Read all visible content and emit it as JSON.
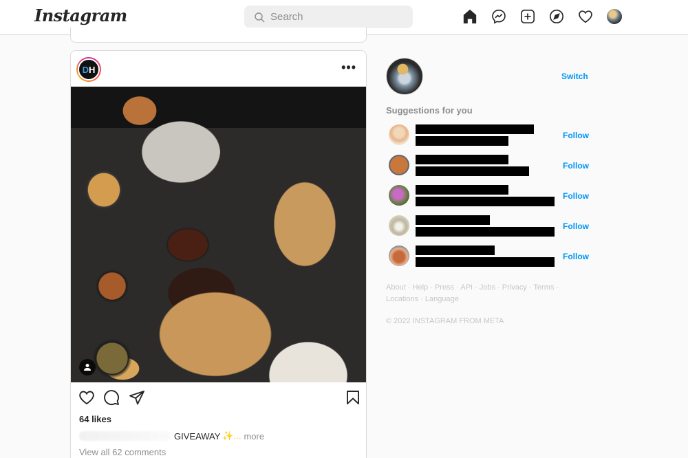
{
  "header": {
    "logo": "Instagram",
    "search_placeholder": "Search",
    "nav_icons": [
      "home-icon",
      "messenger-icon",
      "new-post-icon",
      "explore-icon",
      "activity-heart-icon",
      "profile-avatar"
    ]
  },
  "post": {
    "author_initials": {
      "d": "D",
      "h": "H"
    },
    "more_label": "•••",
    "image_description": "Overhead BBQ spread: ribs, waffle fries, burger, beans, cornbread",
    "likes": "64 likes",
    "caption_text": "GIVEAWAY",
    "caption_emoji": "✨...",
    "caption_more": "more",
    "view_comments": "View all 62 comments"
  },
  "sidebar": {
    "switch_label": "Switch",
    "suggestions_title": "Suggestions for you",
    "suggestions": [
      {
        "follow_label": "Follow",
        "name_redacted": true
      },
      {
        "follow_label": "Follow",
        "name_redacted": true
      },
      {
        "follow_label": "Follow",
        "name_redacted": true
      },
      {
        "follow_label": "Follow",
        "name_redacted": true
      },
      {
        "follow_label": "Follow",
        "name_redacted": true
      }
    ],
    "footer_links": [
      "About",
      "Help",
      "Press",
      "API",
      "Jobs",
      "Privacy",
      "Terms",
      "Locations",
      "Language"
    ],
    "copyright": "© 2022 INSTAGRAM FROM META"
  },
  "colors": {
    "accent_blue": "#0095f6",
    "text_primary": "#262626",
    "text_secondary": "#8e8e8e",
    "background": "#fafafa",
    "border": "#dbdbdb"
  }
}
